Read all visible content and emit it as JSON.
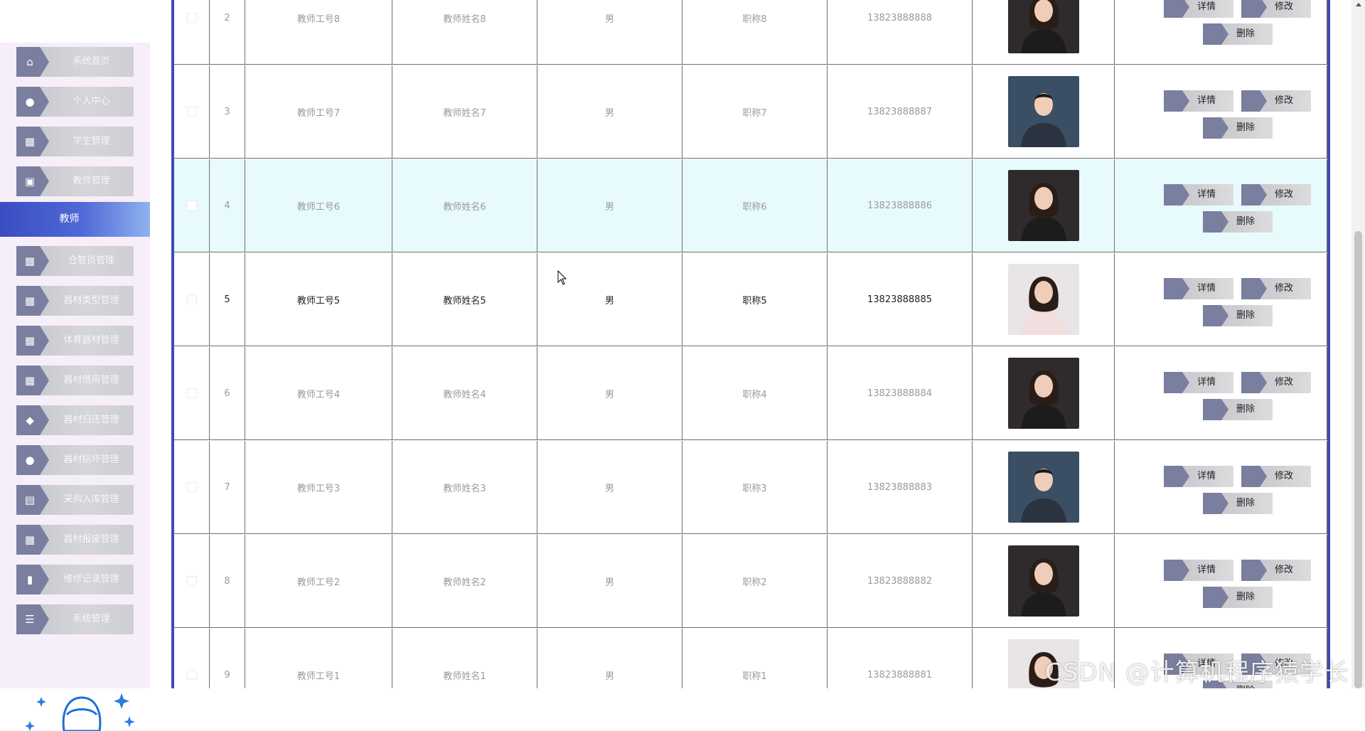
{
  "sidebar": {
    "items": [
      {
        "label": "系统首页",
        "icon": "home-icon",
        "glyph": "⌂"
      },
      {
        "label": "个人中心",
        "icon": "user-icon",
        "glyph": "●"
      },
      {
        "label": "学生管理",
        "icon": "grid-icon",
        "glyph": "▦"
      },
      {
        "label": "教师管理",
        "icon": "chart-icon",
        "glyph": "▣"
      },
      {
        "label": "教师",
        "icon": "",
        "glyph": ""
      },
      {
        "label": "仓管员管理",
        "icon": "grid-icon",
        "glyph": "▦"
      },
      {
        "label": "器材类型管理",
        "icon": "grid-icon",
        "glyph": "▦"
      },
      {
        "label": "体育器材管理",
        "icon": "grid-icon",
        "glyph": "▦"
      },
      {
        "label": "器材借用管理",
        "icon": "grid-icon",
        "glyph": "▦"
      },
      {
        "label": "器材归还管理",
        "icon": "tag-icon",
        "glyph": "◆"
      },
      {
        "label": "器材损坏管理",
        "icon": "bulb-icon",
        "glyph": "●"
      },
      {
        "label": "采购入库管理",
        "icon": "clipboard-icon",
        "glyph": "▤"
      },
      {
        "label": "器材报废管理",
        "icon": "grid-icon",
        "glyph": "▦"
      },
      {
        "label": "维修记录管理",
        "icon": "bar-chart-icon",
        "glyph": "▮"
      },
      {
        "label": "系统管理",
        "icon": "list-icon",
        "glyph": "☰"
      }
    ]
  },
  "table": {
    "actions": {
      "detail": "详情",
      "edit": "修改",
      "delete": "删除"
    },
    "rows": [
      {
        "index": "2",
        "teacher_id": "教师工号8",
        "name": "教师姓名8",
        "gender": "男",
        "title": "职称8",
        "phone": "13823888888",
        "photo": "female"
      },
      {
        "index": "3",
        "teacher_id": "教师工号7",
        "name": "教师姓名7",
        "gender": "男",
        "title": "职称7",
        "phone": "13823888887",
        "photo": "male"
      },
      {
        "index": "4",
        "teacher_id": "教师工号6",
        "name": "教师姓名6",
        "gender": "男",
        "title": "职称6",
        "phone": "13823888886",
        "photo": "female"
      },
      {
        "index": "5",
        "teacher_id": "教师工号5",
        "name": "教师姓名5",
        "gender": "男",
        "title": "职称5",
        "phone": "13823888885",
        "photo": "female-light"
      },
      {
        "index": "6",
        "teacher_id": "教师工号4",
        "name": "教师姓名4",
        "gender": "男",
        "title": "职称4",
        "phone": "13823888884",
        "photo": "female"
      },
      {
        "index": "7",
        "teacher_id": "教师工号3",
        "name": "教师姓名3",
        "gender": "男",
        "title": "职称3",
        "phone": "13823888883",
        "photo": "male"
      },
      {
        "index": "8",
        "teacher_id": "教师工号2",
        "name": "教师姓名2",
        "gender": "男",
        "title": "职称2",
        "phone": "13823888882",
        "photo": "female"
      },
      {
        "index": "9",
        "teacher_id": "教师工号1",
        "name": "教师姓名1",
        "gender": "男",
        "title": "职称1",
        "phone": "13823888881",
        "photo": "female-light"
      }
    ]
  },
  "colors": {
    "frame": "#3f4bb3",
    "active_menu": "#3a4cc0",
    "row_hover": "#e8fbfc",
    "button_tab": "#7a7e9f"
  },
  "watermark": "CSDN @计算机程序猿学长"
}
